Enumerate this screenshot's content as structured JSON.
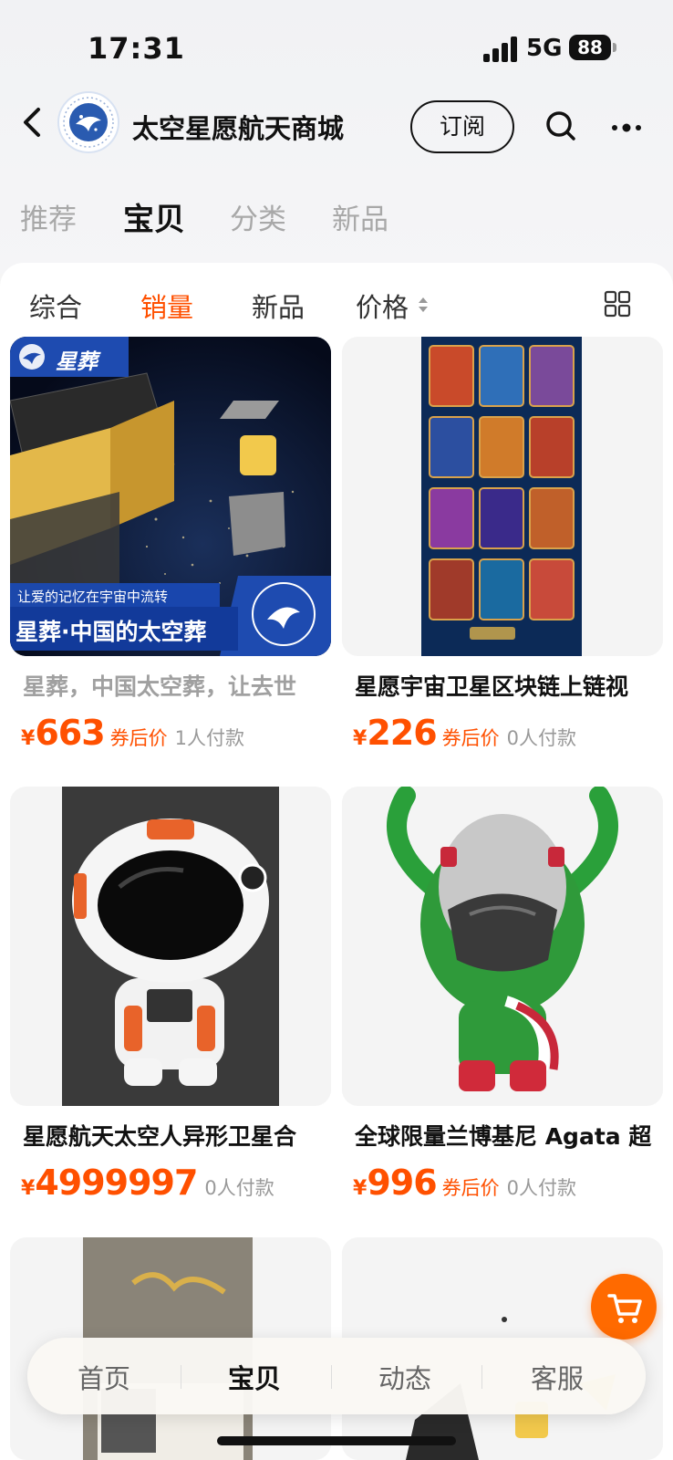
{
  "status": {
    "time": "17:31",
    "network": "5G",
    "battery": "88"
  },
  "header": {
    "shop_name": "太空星愿航天商城",
    "subscribe_label": "订阅"
  },
  "tabs": [
    {
      "label": "推荐"
    },
    {
      "label": "宝贝"
    },
    {
      "label": "分类"
    },
    {
      "label": "新品"
    }
  ],
  "sort": [
    {
      "label": "综合"
    },
    {
      "label": "销量"
    },
    {
      "label": "新品"
    },
    {
      "label": "价格"
    }
  ],
  "products": [
    {
      "title": "星葬，中国太空葬，让去世",
      "yen": "¥",
      "price": "663",
      "coupon": "券后价",
      "sold": "1人付款",
      "banner_tag": "星葬",
      "banner_sub": "让爱的记忆在宇宙中流转",
      "banner_main": "星葬·中国的太空葬"
    },
    {
      "title": "星愿宇宙卫星区块链上链视",
      "yen": "¥",
      "price": "226",
      "coupon": "券后价",
      "sold": "0人付款"
    },
    {
      "title": "星愿航天太空人异形卫星合",
      "yen": "¥",
      "price": "4999997",
      "coupon": "",
      "sold": "0人付款"
    },
    {
      "title": "全球限量兰博基尼 Agata 超",
      "yen": "¥",
      "price": "996",
      "coupon": "券后价",
      "sold": "0人付款"
    }
  ],
  "bottom_nav": [
    {
      "label": "首页"
    },
    {
      "label": "宝贝"
    },
    {
      "label": "动态"
    },
    {
      "label": "客服"
    }
  ],
  "colors": {
    "accent": "#ff5000",
    "fab": "#ff6a00"
  }
}
